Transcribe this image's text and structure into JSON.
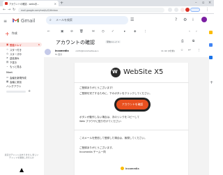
{
  "browser": {
    "tab_title": "アカウントの確認 - webs@...",
    "omnibox_url": "mail.google.com/mail/u/0/#inbox",
    "new_tab": "+",
    "close": "×"
  },
  "gmail": {
    "logo_text": "Gmail",
    "search_placeholder": "メールを検索",
    "compose_label": "作成",
    "sidebar": [
      {
        "label": "受信トレイ",
        "icon": "inbox-icon",
        "active": true,
        "count": "1"
      },
      {
        "label": "スター付き",
        "icon": "star-icon"
      },
      {
        "label": "スヌーズ中",
        "icon": "clock-icon"
      },
      {
        "label": "送信済み",
        "icon": "send-icon"
      },
      {
        "label": "下書き",
        "icon": "draft-icon"
      },
      {
        "label": "もっと見る",
        "icon": "chevron-down-icon"
      }
    ],
    "meet_label": "Meet",
    "meet_items": [
      "会議を新規作成",
      "会議に参加"
    ],
    "hangouts_label": "ハングアウト",
    "sidebar_footer": "最近のチャットはありません 新しいチャットを開始しませんか"
  },
  "message": {
    "subject": "アカウントの確認",
    "label_chip": "受信トレイ ×",
    "sender_name": "incomedia",
    "sender_email": "<info@incomedia.eu>",
    "to": "To 自分",
    "date": "11:42 (0分前)",
    "body": {
      "brand": "WebSite X5",
      "greeting": "ご登録ありがとうございます！",
      "line1": "ご登録を完了するために、下のボタンをクリックしてください。",
      "cta_label": "アカウントを確認",
      "line2": "ボタンが動作しない場合は、次のリンクをコピーして",
      "line3": "Web ブラウザに貼り付けてください：",
      "line4": "このメールを受信して登録した場合は、無視してください。",
      "line5": "ご登録ありがとうございます。",
      "line6": "Incomedia チーム一同",
      "footer_brand": "incomedia"
    }
  },
  "colors": {
    "accent_red": "#d93025",
    "cta_orange": "#e8501f"
  }
}
